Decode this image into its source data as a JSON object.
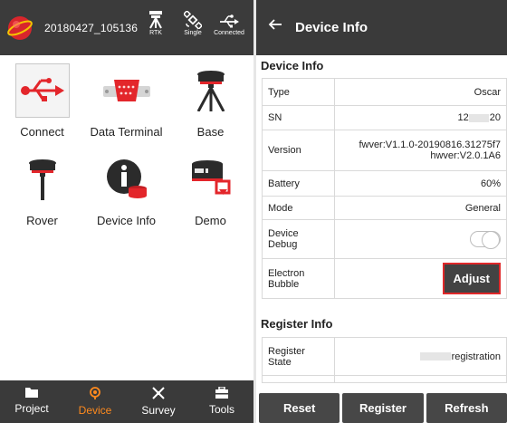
{
  "statusbar": {
    "project_name": "20180427_105136",
    "rtk_label": "RTK",
    "single_label": "Single",
    "connected_label": "Connected"
  },
  "device_menu": {
    "items": [
      {
        "label": "Connect",
        "icon": "usb-icon"
      },
      {
        "label": "Data Terminal",
        "icon": "serial-port-icon"
      },
      {
        "label": "Base",
        "icon": "base-station-icon"
      },
      {
        "label": "Rover",
        "icon": "rover-receiver-icon"
      },
      {
        "label": "Device Info",
        "icon": "info-icon"
      },
      {
        "label": "Demo",
        "icon": "demo-receiver-icon"
      }
    ]
  },
  "bottom_nav": {
    "items": [
      {
        "label": "Project",
        "icon": "folder-icon"
      },
      {
        "label": "Device",
        "icon": "device-icon",
        "active": true
      },
      {
        "label": "Survey",
        "icon": "survey-icon"
      },
      {
        "label": "Tools",
        "icon": "toolbox-icon"
      }
    ]
  },
  "device_info": {
    "header_title": "Device Info",
    "section_title": "Device Info",
    "type_label": "Type",
    "type_value": "Oscar",
    "sn_label": "SN",
    "sn_prefix": "12",
    "sn_suffix": "20",
    "version_label": "Version",
    "fw_version": "fwver:V1.1.0-20190816.31275f7",
    "hw_version": "hwver:V2.0.1A6",
    "battery_label": "Battery",
    "battery_value": "60%",
    "mode_label": "Mode",
    "mode_value": "General",
    "debug_label": "Device Debug",
    "debug_on": false,
    "bubble_label": "Electron Bubble",
    "adjust_label": "Adjust"
  },
  "register_info": {
    "section_title": "Register Info",
    "state_label": "Register State",
    "state_value": "registration"
  },
  "actions": {
    "reset_label": "Reset",
    "register_label": "Register",
    "refresh_label": "Refresh"
  },
  "colors": {
    "header_bg": "#3a3a3a",
    "active_nav": "#ff8a1e",
    "highlight_border": "#e0282a",
    "logo_red": "#d8262c"
  }
}
